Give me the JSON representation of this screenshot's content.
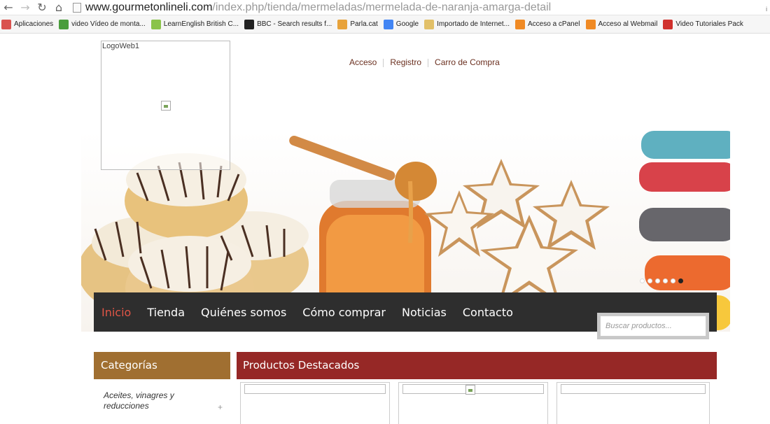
{
  "browser": {
    "url_host": "www.gourmetonlineli.com",
    "url_path": "/index.php/tienda/mermeladas/mermelada-de-naranja-amarga-detail",
    "end_glyph": "ᵢ",
    "bookmarks": [
      {
        "label": "Aplicaciones",
        "color": "#d9534f"
      },
      {
        "label": "video Vídeo de monta...",
        "color": "#4a9d3c"
      },
      {
        "label": "LearnEnglish  British C...",
        "color": "#8bc34a"
      },
      {
        "label": "BBC - Search results f...",
        "color": "#222222"
      },
      {
        "label": "Parla.cat",
        "color": "#e8a33b"
      },
      {
        "label": "Google",
        "color": "#4285f4"
      },
      {
        "label": "Importado de Internet...",
        "color": "#e2c068"
      },
      {
        "label": "Acceso a cPanel",
        "color": "#f08a24"
      },
      {
        "label": "Acceso al Webmail",
        "color": "#f08a24"
      },
      {
        "label": "Video Tutoriales Pack",
        "color": "#d0312d"
      }
    ]
  },
  "site": {
    "logo_alt": "LogoWeb1",
    "top_links": [
      "Acceso",
      "Registro",
      "Carro de Compra"
    ],
    "nav": [
      "Inicio",
      "Tienda",
      "Quiénes somos",
      "Cómo comprar",
      "Noticias",
      "Contacto"
    ],
    "search_placeholder": "Buscar productos...",
    "categories_title": "Categorías",
    "category_first": "Aceites, vinagres y reducciones",
    "featured_title": "Productos Destacados",
    "slider_dots": 6,
    "slider_active": 5,
    "colors": {
      "nav_active": "#e05546",
      "categories": "#a06f31",
      "featured": "#962826",
      "nav_bg": "#2e2e2e"
    }
  }
}
